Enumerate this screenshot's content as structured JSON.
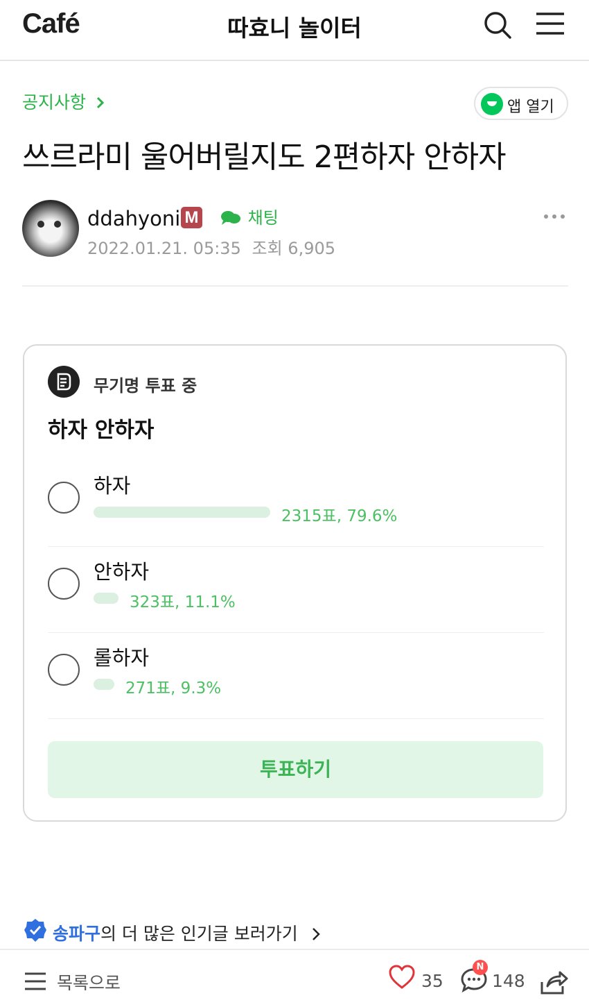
{
  "header": {
    "logo": "Café",
    "cafe_name": "따효니 놀이터",
    "icons": {
      "search": "search-icon",
      "menu": "hamburger-menu-icon"
    }
  },
  "article": {
    "board": "공지사항",
    "app_open": "앱 열기",
    "title": "쓰르라미 울어버릴지도 2편하자 안하자",
    "author": {
      "nickname": "ddahyoni",
      "badge": "M",
      "chat_label": "채팅"
    },
    "date": "2022.01.21. 05:35",
    "views_label": "조회",
    "views": "6,905"
  },
  "poll": {
    "status": "무기명 투표 중",
    "question": "하자 안하자",
    "options": [
      {
        "label": "하자",
        "result": "2315표, 79.6%",
        "percent": 79.6
      },
      {
        "label": "안하자",
        "result": "323표, 11.1%",
        "percent": 11.1
      },
      {
        "label": "롤하자",
        "result": "271표, 9.3%",
        "percent": 9.3
      }
    ],
    "vote_button": "투표하기"
  },
  "popular": {
    "location": "송파구",
    "rest": "의 더 많은 인기글 보러가기"
  },
  "bottombar": {
    "list_label": "목록으로",
    "likes": "35",
    "comments": "148",
    "new_badge": "N"
  },
  "colors": {
    "accent_green": "#2cb24a",
    "bar_green": "#dbf0e1",
    "vote_button_bg": "#e2f6e7",
    "badge_red": "#b5464d",
    "location_blue": "#2f6fe0"
  }
}
